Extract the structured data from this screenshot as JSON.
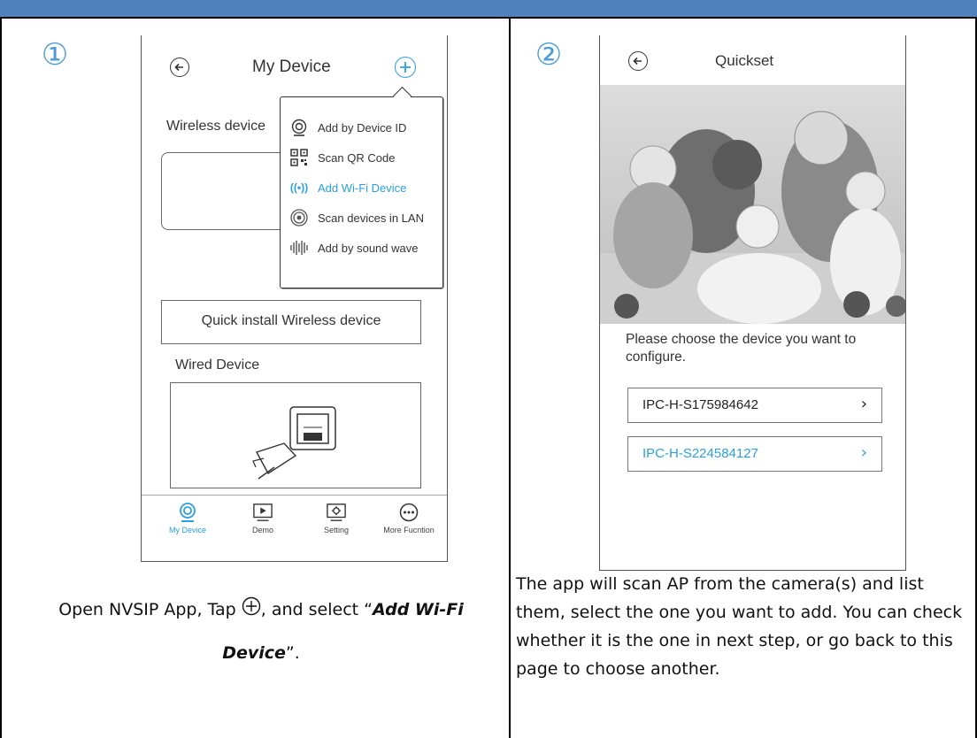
{
  "step1": {
    "number": "①",
    "header_title": "My Device",
    "wireless_label": "Wireless device",
    "menu_items": [
      {
        "label": "Add by Device ID",
        "icon": "camera-icon",
        "highlight": false
      },
      {
        "label": "Scan QR Code",
        "icon": "qr-code-icon",
        "highlight": false
      },
      {
        "label": "Add Wi-Fi Device",
        "icon": "wifi-signal-icon",
        "highlight": true
      },
      {
        "label": "Scan devices in LAN",
        "icon": "lan-scan-icon",
        "highlight": false
      },
      {
        "label": "Add by sound wave",
        "icon": "sound-wave-icon",
        "highlight": false
      }
    ],
    "quick_install": "Quick install Wireless device",
    "wired_label": "Wired Device",
    "tabs": [
      {
        "label": "My Device",
        "active": true
      },
      {
        "label": "Demo",
        "active": false
      },
      {
        "label": "Setting",
        "active": false
      },
      {
        "label": "More Fucntion",
        "active": false
      }
    ],
    "caption": {
      "part1": "Open NVSIP App, Tap ",
      "part2": ", and select “",
      "bold": "Add Wi-Fi Device",
      "part3": "”."
    }
  },
  "step2": {
    "number": "②",
    "header_title": "Quickset",
    "prompt": "Please choose the device you want to configure.",
    "devices": [
      {
        "name": "IPC-H-S175984642",
        "highlight": false
      },
      {
        "name": "IPC-H-S224584127",
        "highlight": true
      }
    ],
    "caption": "The app will scan AP from the camera(s) and list them, select the one you want to add. You can check whether it is the one in next step, or go back to this page to choose another."
  },
  "colors": {
    "accent": "#2b9fe0",
    "header_bar": "#4f81bd",
    "step_number": "#4f9bd6"
  }
}
